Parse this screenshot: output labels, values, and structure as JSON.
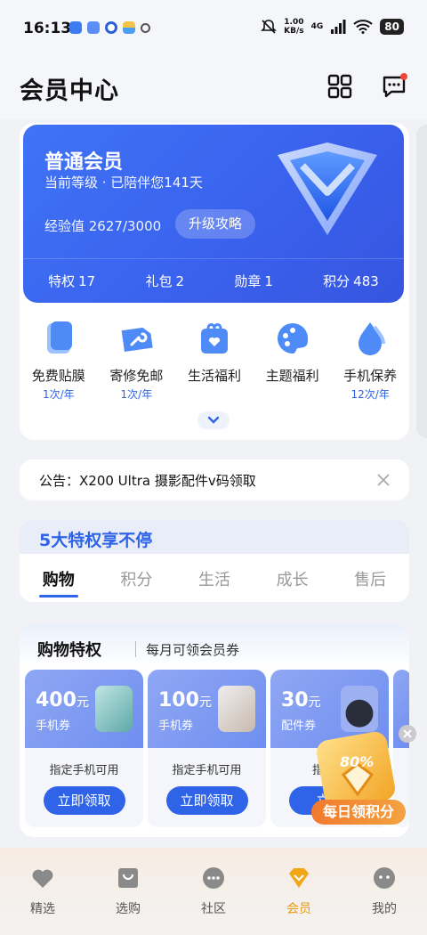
{
  "status": {
    "time": "16:13",
    "speed_value": "1.00",
    "speed_unit": "KB/s",
    "network": "4G",
    "battery": "80"
  },
  "header": {
    "title": "会员中心"
  },
  "member": {
    "level_title": "普通会员",
    "subtitle": "当前等级 · 已陪伴您141天",
    "exp": "经验值 2627/3000",
    "upgrade": "升级攻略",
    "stats": [
      {
        "label": "特权",
        "value": "17"
      },
      {
        "label": "礼包",
        "value": "2"
      },
      {
        "label": "勋章",
        "value": "1"
      },
      {
        "label": "积分",
        "value": "483"
      }
    ]
  },
  "quick": [
    {
      "label": "免费贴膜",
      "sub": "1次/年",
      "icon": "screen-film-icon"
    },
    {
      "label": "寄修免邮",
      "sub": "1次/年",
      "icon": "wrench-icon"
    },
    {
      "label": "生活福利",
      "sub": "",
      "icon": "gift-heart-icon"
    },
    {
      "label": "主题福利",
      "sub": "",
      "icon": "palette-icon"
    },
    {
      "label": "手机保养",
      "sub": "12次/年",
      "icon": "water-drop-icon"
    }
  ],
  "notice": {
    "text": "公告：X200 Ultra 摄影配件v码领取"
  },
  "privileges": {
    "title": "5大特权享不停",
    "tabs": [
      "购物",
      "积分",
      "生活",
      "成长",
      "售后"
    ],
    "active_tab": 0
  },
  "shopping": {
    "title": "购物特权",
    "subtitle": "每月可领会员券",
    "coupons": [
      {
        "amount": "400",
        "unit": "元",
        "type": "手机券",
        "desc": "指定手机可用",
        "button": "立即领取"
      },
      {
        "amount": "100",
        "unit": "元",
        "type": "手机券",
        "desc": "指定手机可用",
        "button": "立即领取"
      },
      {
        "amount": "30",
        "unit": "元",
        "type": "配件券",
        "desc": "指定耳",
        "button": "立即"
      }
    ]
  },
  "float_badge": {
    "percent": "80%",
    "label": "每日领积分"
  },
  "nav": [
    {
      "label": "精选",
      "icon": "heart-icon"
    },
    {
      "label": "选购",
      "icon": "shopping-bag-icon"
    },
    {
      "label": "社区",
      "icon": "chat-icon"
    },
    {
      "label": "会员",
      "icon": "diamond-icon",
      "active": true
    },
    {
      "label": "我的",
      "icon": "face-icon"
    }
  ],
  "colors": {
    "accent": "#2f63e8",
    "card_blue": "#3a62ee",
    "nav_active": "#e79b12"
  }
}
